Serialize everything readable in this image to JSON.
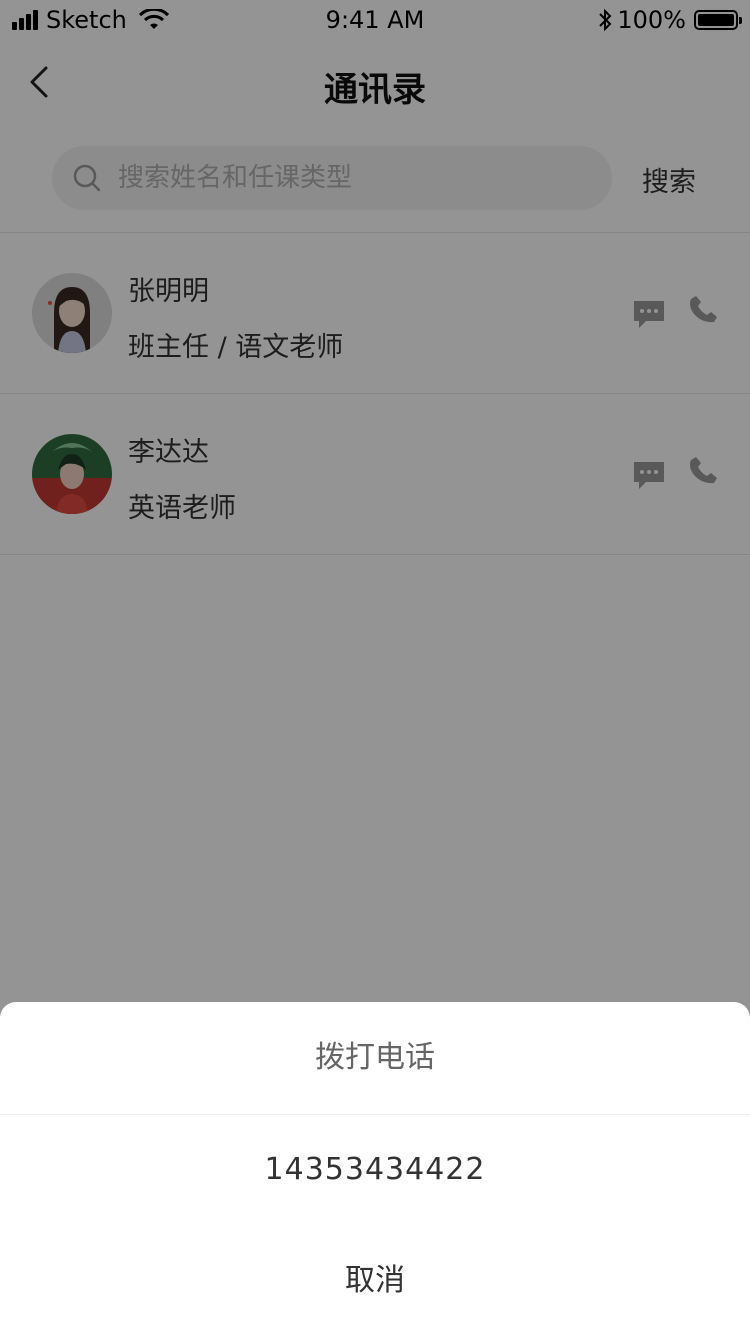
{
  "status_bar": {
    "carrier": "Sketch",
    "time": "9:41 AM",
    "battery": "100%"
  },
  "nav": {
    "title": "通讯录",
    "back_icon": "chevron-left-icon"
  },
  "search": {
    "placeholder": "搜索姓名和任课类型",
    "button_label": "搜索"
  },
  "contacts": [
    {
      "name": "张明明",
      "role": "班主任 / 语文老师"
    },
    {
      "name": "李达达",
      "role": "英语老师"
    }
  ],
  "dial_sheet": {
    "title": "拨打电话",
    "phone_number": "14353434422",
    "cancel_label": "取消"
  },
  "colors": {
    "overlay": "rgba(0,0,0,0.42)",
    "text_primary": "#333333",
    "icon_gray": "#9a9a9a"
  }
}
